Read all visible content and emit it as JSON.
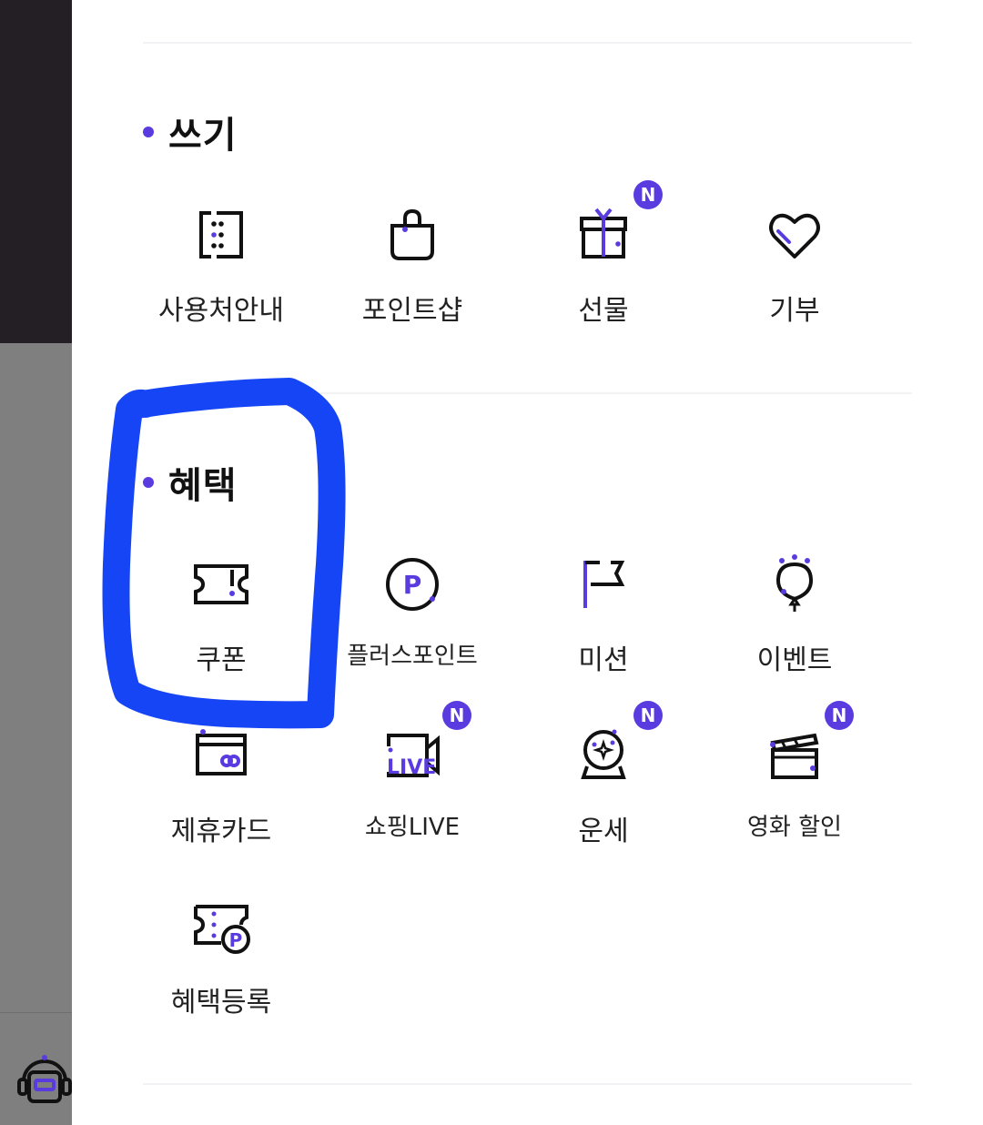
{
  "colors": {
    "accent": "#5a3be0",
    "annotation": "#1545f5",
    "dark_strip": "#231f24"
  },
  "sections": {
    "write": {
      "title": "쓰기",
      "items": [
        {
          "label": "사용처안내",
          "icon": "usage-guide-icon"
        },
        {
          "label": "포인트샵",
          "icon": "shopping-bag-icon"
        },
        {
          "label": "선물",
          "icon": "gift-icon",
          "badge": "N"
        },
        {
          "label": "기부",
          "icon": "heart-icon"
        }
      ]
    },
    "benefit": {
      "title": "혜택",
      "items": [
        {
          "label": "쿠폰",
          "icon": "coupon-ticket-icon"
        },
        {
          "label": "플러스포인트",
          "icon": "plus-point-icon"
        },
        {
          "label": "미션",
          "icon": "flag-icon"
        },
        {
          "label": "이벤트",
          "icon": "balloon-icon"
        },
        {
          "label": "제휴카드",
          "icon": "credit-card-icon"
        },
        {
          "label": "쇼핑LIVE",
          "icon": "live-camera-icon",
          "badge": "N"
        },
        {
          "label": "운세",
          "icon": "crystal-ball-icon",
          "badge": "N"
        },
        {
          "label": "영화 할인",
          "icon": "movie-clapper-icon",
          "badge": "N"
        },
        {
          "label": "혜택등록",
          "icon": "coupon-point-register-icon"
        }
      ]
    }
  }
}
